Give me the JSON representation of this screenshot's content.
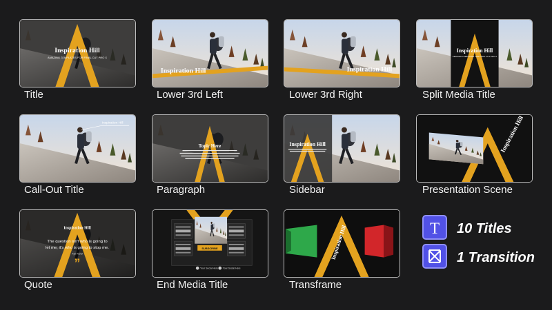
{
  "tiles": [
    {
      "label": "Title",
      "caption": "Inspiration Hill",
      "sub": "AMAZING TEMPLATES FOR FINAL CUT PRO X"
    },
    {
      "label": "Lower 3rd Left",
      "caption": "Inspiration Hill"
    },
    {
      "label": "Lower 3rd Right",
      "caption": "Inspiration Hill"
    },
    {
      "label": "Split Media Title",
      "caption": "Inspiration Hill",
      "sub": "AMAZING TEMPLATES FOR FINAL CUT PRO X"
    },
    {
      "label": "Call-Out Title",
      "caption": "Inspiration Hill"
    },
    {
      "label": "Paragraph",
      "caption": "Topic Here"
    },
    {
      "label": "Sidebar",
      "caption": "Inspiration Hill"
    },
    {
      "label": "Presentation Scene",
      "caption": "Inspiration Hill"
    },
    {
      "label": "Quote",
      "caption": "Inspiration Hill",
      "quote1": "The question isn't who is going to",
      "quote2": "let me; it's who is going to stop me.",
      "author": "Ayn Rand"
    },
    {
      "label": "End Media Title",
      "sub": "Your Social Here",
      "button": "SUBSCRIBE"
    },
    {
      "label": "Transframe",
      "caption": "Inspiration Hill"
    }
  ],
  "summary": {
    "titles_icon": "T",
    "titles_text": "10 Titles",
    "transition_text": "1 Transition"
  },
  "colors": {
    "accent": "#e3a21f",
    "icon_bg": "#5151e6",
    "background": "#1b1b1c"
  }
}
